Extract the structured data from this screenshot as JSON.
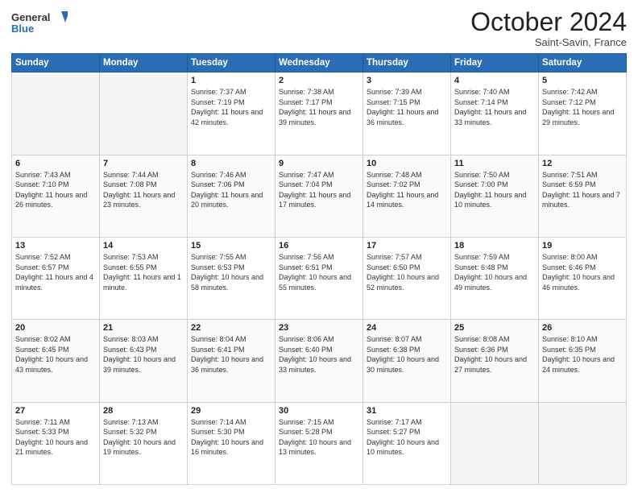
{
  "header": {
    "logo_general": "General",
    "logo_blue": "Blue",
    "month_title": "October 2024",
    "subtitle": "Saint-Savin, France"
  },
  "days_of_week": [
    "Sunday",
    "Monday",
    "Tuesday",
    "Wednesday",
    "Thursday",
    "Friday",
    "Saturday"
  ],
  "weeks": [
    [
      {
        "day": "",
        "empty": true
      },
      {
        "day": "",
        "empty": true
      },
      {
        "day": "1",
        "sunrise": "Sunrise: 7:37 AM",
        "sunset": "Sunset: 7:19 PM",
        "daylight": "Daylight: 11 hours and 42 minutes."
      },
      {
        "day": "2",
        "sunrise": "Sunrise: 7:38 AM",
        "sunset": "Sunset: 7:17 PM",
        "daylight": "Daylight: 11 hours and 39 minutes."
      },
      {
        "day": "3",
        "sunrise": "Sunrise: 7:39 AM",
        "sunset": "Sunset: 7:15 PM",
        "daylight": "Daylight: 11 hours and 36 minutes."
      },
      {
        "day": "4",
        "sunrise": "Sunrise: 7:40 AM",
        "sunset": "Sunset: 7:14 PM",
        "daylight": "Daylight: 11 hours and 33 minutes."
      },
      {
        "day": "5",
        "sunrise": "Sunrise: 7:42 AM",
        "sunset": "Sunset: 7:12 PM",
        "daylight": "Daylight: 11 hours and 29 minutes."
      }
    ],
    [
      {
        "day": "6",
        "sunrise": "Sunrise: 7:43 AM",
        "sunset": "Sunset: 7:10 PM",
        "daylight": "Daylight: 11 hours and 26 minutes."
      },
      {
        "day": "7",
        "sunrise": "Sunrise: 7:44 AM",
        "sunset": "Sunset: 7:08 PM",
        "daylight": "Daylight: 11 hours and 23 minutes."
      },
      {
        "day": "8",
        "sunrise": "Sunrise: 7:46 AM",
        "sunset": "Sunset: 7:06 PM",
        "daylight": "Daylight: 11 hours and 20 minutes."
      },
      {
        "day": "9",
        "sunrise": "Sunrise: 7:47 AM",
        "sunset": "Sunset: 7:04 PM",
        "daylight": "Daylight: 11 hours and 17 minutes."
      },
      {
        "day": "10",
        "sunrise": "Sunrise: 7:48 AM",
        "sunset": "Sunset: 7:02 PM",
        "daylight": "Daylight: 11 hours and 14 minutes."
      },
      {
        "day": "11",
        "sunrise": "Sunrise: 7:50 AM",
        "sunset": "Sunset: 7:00 PM",
        "daylight": "Daylight: 11 hours and 10 minutes."
      },
      {
        "day": "12",
        "sunrise": "Sunrise: 7:51 AM",
        "sunset": "Sunset: 6:59 PM",
        "daylight": "Daylight: 11 hours and 7 minutes."
      }
    ],
    [
      {
        "day": "13",
        "sunrise": "Sunrise: 7:52 AM",
        "sunset": "Sunset: 6:57 PM",
        "daylight": "Daylight: 11 hours and 4 minutes."
      },
      {
        "day": "14",
        "sunrise": "Sunrise: 7:53 AM",
        "sunset": "Sunset: 6:55 PM",
        "daylight": "Daylight: 11 hours and 1 minute."
      },
      {
        "day": "15",
        "sunrise": "Sunrise: 7:55 AM",
        "sunset": "Sunset: 6:53 PM",
        "daylight": "Daylight: 10 hours and 58 minutes."
      },
      {
        "day": "16",
        "sunrise": "Sunrise: 7:56 AM",
        "sunset": "Sunset: 6:51 PM",
        "daylight": "Daylight: 10 hours and 55 minutes."
      },
      {
        "day": "17",
        "sunrise": "Sunrise: 7:57 AM",
        "sunset": "Sunset: 6:50 PM",
        "daylight": "Daylight: 10 hours and 52 minutes."
      },
      {
        "day": "18",
        "sunrise": "Sunrise: 7:59 AM",
        "sunset": "Sunset: 6:48 PM",
        "daylight": "Daylight: 10 hours and 49 minutes."
      },
      {
        "day": "19",
        "sunrise": "Sunrise: 8:00 AM",
        "sunset": "Sunset: 6:46 PM",
        "daylight": "Daylight: 10 hours and 46 minutes."
      }
    ],
    [
      {
        "day": "20",
        "sunrise": "Sunrise: 8:02 AM",
        "sunset": "Sunset: 6:45 PM",
        "daylight": "Daylight: 10 hours and 43 minutes."
      },
      {
        "day": "21",
        "sunrise": "Sunrise: 8:03 AM",
        "sunset": "Sunset: 6:43 PM",
        "daylight": "Daylight: 10 hours and 39 minutes."
      },
      {
        "day": "22",
        "sunrise": "Sunrise: 8:04 AM",
        "sunset": "Sunset: 6:41 PM",
        "daylight": "Daylight: 10 hours and 36 minutes."
      },
      {
        "day": "23",
        "sunrise": "Sunrise: 8:06 AM",
        "sunset": "Sunset: 6:40 PM",
        "daylight": "Daylight: 10 hours and 33 minutes."
      },
      {
        "day": "24",
        "sunrise": "Sunrise: 8:07 AM",
        "sunset": "Sunset: 6:38 PM",
        "daylight": "Daylight: 10 hours and 30 minutes."
      },
      {
        "day": "25",
        "sunrise": "Sunrise: 8:08 AM",
        "sunset": "Sunset: 6:36 PM",
        "daylight": "Daylight: 10 hours and 27 minutes."
      },
      {
        "day": "26",
        "sunrise": "Sunrise: 8:10 AM",
        "sunset": "Sunset: 6:35 PM",
        "daylight": "Daylight: 10 hours and 24 minutes."
      }
    ],
    [
      {
        "day": "27",
        "sunrise": "Sunrise: 7:11 AM",
        "sunset": "Sunset: 5:33 PM",
        "daylight": "Daylight: 10 hours and 21 minutes."
      },
      {
        "day": "28",
        "sunrise": "Sunrise: 7:13 AM",
        "sunset": "Sunset: 5:32 PM",
        "daylight": "Daylight: 10 hours and 19 minutes."
      },
      {
        "day": "29",
        "sunrise": "Sunrise: 7:14 AM",
        "sunset": "Sunset: 5:30 PM",
        "daylight": "Daylight: 10 hours and 16 minutes."
      },
      {
        "day": "30",
        "sunrise": "Sunrise: 7:15 AM",
        "sunset": "Sunset: 5:28 PM",
        "daylight": "Daylight: 10 hours and 13 minutes."
      },
      {
        "day": "31",
        "sunrise": "Sunrise: 7:17 AM",
        "sunset": "Sunset: 5:27 PM",
        "daylight": "Daylight: 10 hours and 10 minutes."
      },
      {
        "day": "",
        "empty": true
      },
      {
        "day": "",
        "empty": true
      }
    ]
  ]
}
